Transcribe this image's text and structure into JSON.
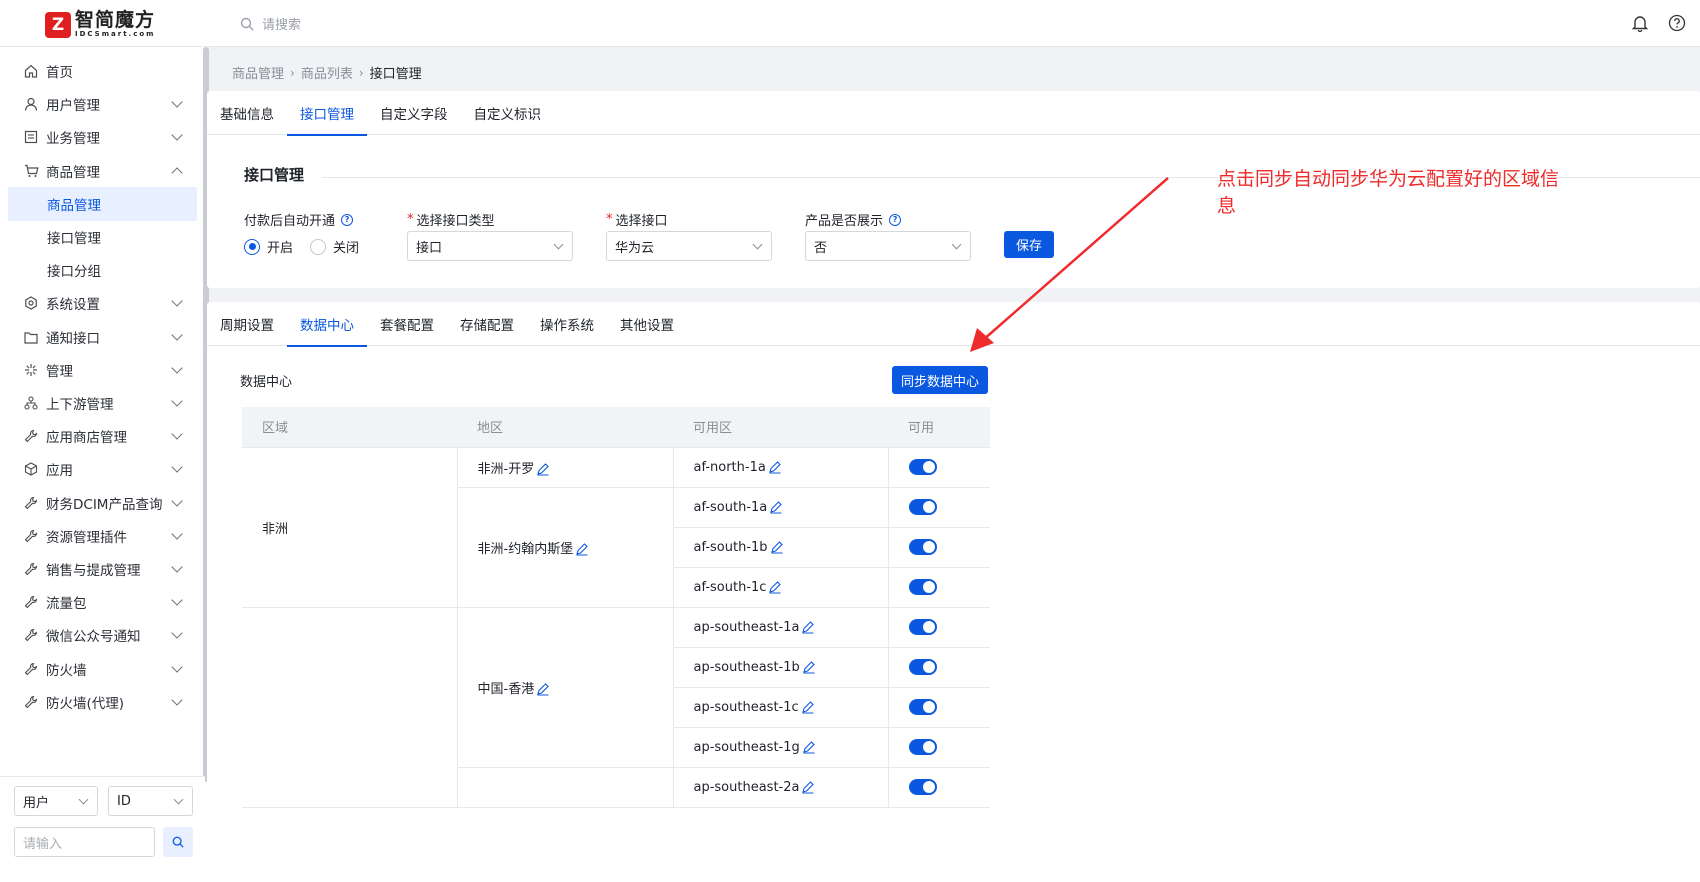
{
  "app": {
    "logo_text": "智简魔方",
    "logo_sub": "IDCSmart.com",
    "search_placeholder": "请搜索"
  },
  "sidebar": {
    "items": [
      {
        "label": "首页",
        "icon": "home-icon"
      },
      {
        "label": "用户管理",
        "icon": "user-icon"
      },
      {
        "label": "业务管理",
        "icon": "document-icon"
      },
      {
        "label": "商品管理",
        "icon": "cart-icon"
      },
      {
        "label": "商品管理"
      },
      {
        "label": "接口管理"
      },
      {
        "label": "接口分组"
      },
      {
        "label": "系统设置",
        "icon": "gear-icon"
      },
      {
        "label": "通知接口",
        "icon": "folder-icon"
      },
      {
        "label": "管理",
        "icon": "sparkle-icon"
      },
      {
        "label": "上下游管理",
        "icon": "hierarchy-icon"
      },
      {
        "label": "应用商店管理",
        "icon": "wrench-icon"
      },
      {
        "label": "应用",
        "icon": "cube-icon"
      },
      {
        "label": "财务DCIM产品查询",
        "icon": "wrench-icon"
      },
      {
        "label": "资源管理插件",
        "icon": "wrench-icon"
      },
      {
        "label": "销售与提成管理",
        "icon": "wrench-icon"
      },
      {
        "label": "流量包",
        "icon": "wrench-icon"
      },
      {
        "label": "微信公众号通知",
        "icon": "wrench-icon"
      },
      {
        "label": "防火墙",
        "icon": "wrench-icon"
      },
      {
        "label": "防火墙(代理)",
        "icon": "wrench-icon"
      }
    ],
    "filter_type": "用户",
    "filter_field": "ID",
    "filter_placeholder": "请输入"
  },
  "breadcrumb": [
    "商品管理",
    "商品列表",
    "接口管理"
  ],
  "top_tabs": [
    "基础信息",
    "接口管理",
    "自定义字段",
    "自定义标识"
  ],
  "interface_section": {
    "title": "接口管理",
    "auto_open_label": "付款后自动开通",
    "radio_on": "开启",
    "radio_off": "关闭",
    "type_label": "选择接口类型",
    "type_value": "接口",
    "interface_label": "选择接口",
    "interface_value": "华为云",
    "display_label": "产品是否展示",
    "display_value": "否",
    "save_button": "保存"
  },
  "config_tabs": [
    "周期设置",
    "数据中心",
    "套餐配置",
    "存储配置",
    "操作系统",
    "其他设置"
  ],
  "datacenter": {
    "title": "数据中心",
    "sync_button": "同步数据中心",
    "columns": [
      "区域",
      "地区",
      "可用区",
      "可用"
    ],
    "regions": [
      "非洲"
    ],
    "areas": [
      "非洲-开罗",
      "非洲-约翰内斯堡",
      "中国-香港"
    ],
    "zones": [
      "af-north-1a",
      "af-south-1a",
      "af-south-1b",
      "af-south-1c",
      "ap-southeast-1a",
      "ap-southeast-1b",
      "ap-southeast-1c",
      "ap-southeast-1g",
      "ap-southeast-2a"
    ]
  },
  "annotation": "点击同步自动同步华为云配置好的区域信息",
  "colors": {
    "primary": "#0a58e0",
    "annotation": "#ef2b2b"
  }
}
